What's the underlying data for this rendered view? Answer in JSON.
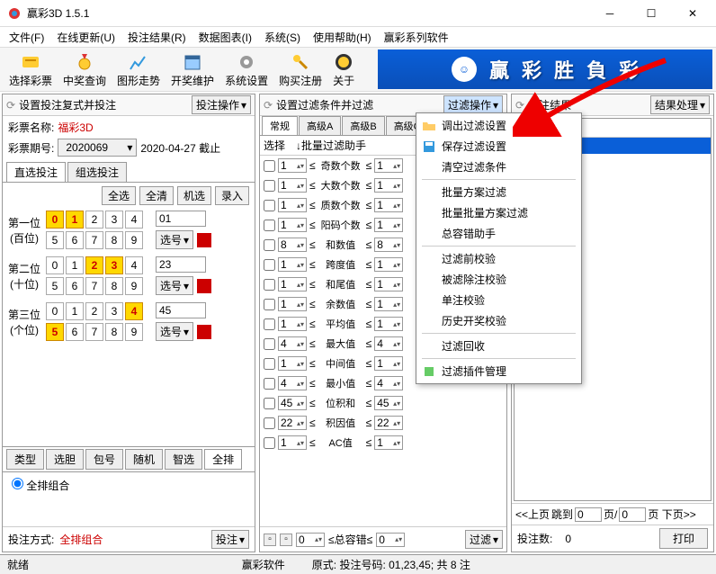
{
  "window": {
    "title": "赢彩3D 1.5.1"
  },
  "menu": {
    "file": "文件(F)",
    "update": "在线更新(U)",
    "betResult": "投注结果(R)",
    "dataChart": "数据图表(I)",
    "system": "系统(S)",
    "help": "使用帮助(H)",
    "series": "赢彩系列软件"
  },
  "toolbar": {
    "selectTicket": "选择彩票",
    "prizeQuery": "中奖查询",
    "trendChart": "图形走势",
    "drawMaint": "开奖维护",
    "sysSettings": "系统设置",
    "buyReg": "购买注册",
    "about": "关于"
  },
  "banner": {
    "c1": "贏",
    "c2": "彩",
    "c3": "胜",
    "c4": "負",
    "c5": "彩"
  },
  "leftPanel": {
    "title": "设置投注复式并投注",
    "opBtn": "投注操作",
    "nameLabel": "彩票名称:",
    "name": "福彩3D",
    "periodLabel": "彩票期号:",
    "period": "2020069",
    "deadline": "2020-04-27 截止",
    "tabDirect": "直选投注",
    "tabGroup": "组选投注",
    "btnAll": "全选",
    "btnClear": "全清",
    "btnRandom": "机选",
    "btnEnter": "录入",
    "pos1": "第一位",
    "pos1sub": "(百位)",
    "pos1val": "01",
    "pos1btn": "选号",
    "pos2": "第二位",
    "pos2sub": "(十位)",
    "pos2val": "23",
    "pos2btn": "选号",
    "pos3": "第三位",
    "pos3sub": "(个位)",
    "pos3val": "45",
    "pos3btn": "选号",
    "typeTabs": {
      "type": "类型",
      "dan": "选胆",
      "bao": "包号",
      "random": "随机",
      "smart": "智选",
      "full": "全排"
    },
    "radio": "全排组合",
    "footerLabel": "投注方式:",
    "footerValue": "全排组合",
    "footerBtn": "投注"
  },
  "midPanel": {
    "title": "设置过滤条件并过滤",
    "opBtn": "过滤操作",
    "tabs": {
      "normal": "常规",
      "advA": "高级A",
      "advB": "高级B",
      "advC": "高级C"
    },
    "colSelect": "选择",
    "colHelper": "↓批量过滤助手",
    "rows": [
      {
        "lo": "1",
        "name": "奇数个数",
        "hi": "1"
      },
      {
        "lo": "1",
        "name": "大数个数",
        "hi": "1"
      },
      {
        "lo": "1",
        "name": "质数个数",
        "hi": "1"
      },
      {
        "lo": "1",
        "name": "阳码个数",
        "hi": "1"
      },
      {
        "lo": "8",
        "name": "和数值",
        "hi": "8"
      },
      {
        "lo": "1",
        "name": "跨度值",
        "hi": "1"
      },
      {
        "lo": "1",
        "name": "和尾值",
        "hi": "1"
      },
      {
        "lo": "1",
        "name": "余数值",
        "hi": "1"
      },
      {
        "lo": "1",
        "name": "平均值",
        "hi": "1"
      },
      {
        "lo": "4",
        "name": "最大值",
        "hi": "4"
      },
      {
        "lo": "1",
        "name": "中间值",
        "hi": "1"
      },
      {
        "lo": "4",
        "name": "最小值",
        "hi": "4"
      },
      {
        "lo": "45",
        "name": "位积和",
        "hi": "45"
      },
      {
        "lo": "22",
        "name": "积因值",
        "hi": "22"
      },
      {
        "lo": "1",
        "name": "AC值",
        "hi": "1"
      }
    ],
    "footer": {
      "total": "≤总容错≤",
      "v1": "0",
      "v2": "0",
      "btn": "过滤"
    }
  },
  "rightPanel": {
    "title": "投注结果",
    "opBtn": "结果处理",
    "resultHeader": "注结果",
    "pager": {
      "prev": "<<上页",
      "jump": "跳到",
      "v1": "0",
      "page": "页/",
      "v2": "0",
      "next": "页 下页>>"
    },
    "footer": {
      "label": "投注数:",
      "count": "0",
      "btn": "打印"
    }
  },
  "dropdown": {
    "loadFilter": "调出过滤设置",
    "saveFilter": "保存过滤设置",
    "clearFilter": "清空过滤条件",
    "batchPlan": "批量方案过滤",
    "batchBatch": "批量批量方案过滤",
    "totalHelper": "总容错助手",
    "preCheck": "过滤前校验",
    "removedCheck": "被滤除注校验",
    "singleCheck": "单注校验",
    "historyCheck": "历史开奖校验",
    "recycle": "过滤回收",
    "plugin": "过滤插件管理"
  },
  "statusbar": {
    "ready": "就绪",
    "app": "赢彩软件",
    "formula": "原式: 投注号码: 01,23,45; 共 8 注"
  }
}
